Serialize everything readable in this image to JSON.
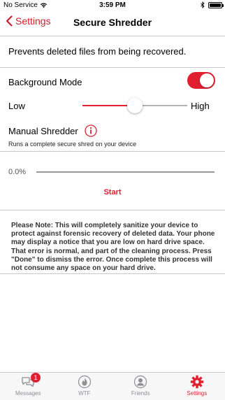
{
  "status_bar": {
    "carrier": "No Service",
    "time": "3:59 PM",
    "battery_level": 1.0
  },
  "nav": {
    "back_label": "Settings",
    "title": "Secure Shredder"
  },
  "description": "Prevents deleted files from being recovered.",
  "background_mode": {
    "label": "Background Mode",
    "enabled": true
  },
  "level_slider": {
    "low_label": "Low",
    "high_label": "High",
    "value": 0.5
  },
  "manual_shredder": {
    "title": "Manual Shredder",
    "subtitle": "Runs a complete secure shred on your device",
    "info_icon": "info-icon"
  },
  "progress": {
    "label": "0.0%",
    "value": 0.0
  },
  "start_label": "Start",
  "note": "Please Note: This will completely sanitize your device to protect against forensic recovery of deleted data. Your phone may display a notice that you are low on hard drive space. That error is normal, and part of the cleaning process. Press \"Done\" to dismiss the error. Once complete this process will not consume any space on your hard drive.",
  "tabs": [
    {
      "label": "Messages",
      "icon": "messages-icon",
      "badge": "1"
    },
    {
      "label": "WTF",
      "icon": "flame-icon"
    },
    {
      "label": "Friends",
      "icon": "person-icon"
    },
    {
      "label": "Settings",
      "icon": "gear-icon",
      "active": true
    }
  ],
  "colors": {
    "accent": "#e02030",
    "tab_inactive": "#8e8e93"
  }
}
